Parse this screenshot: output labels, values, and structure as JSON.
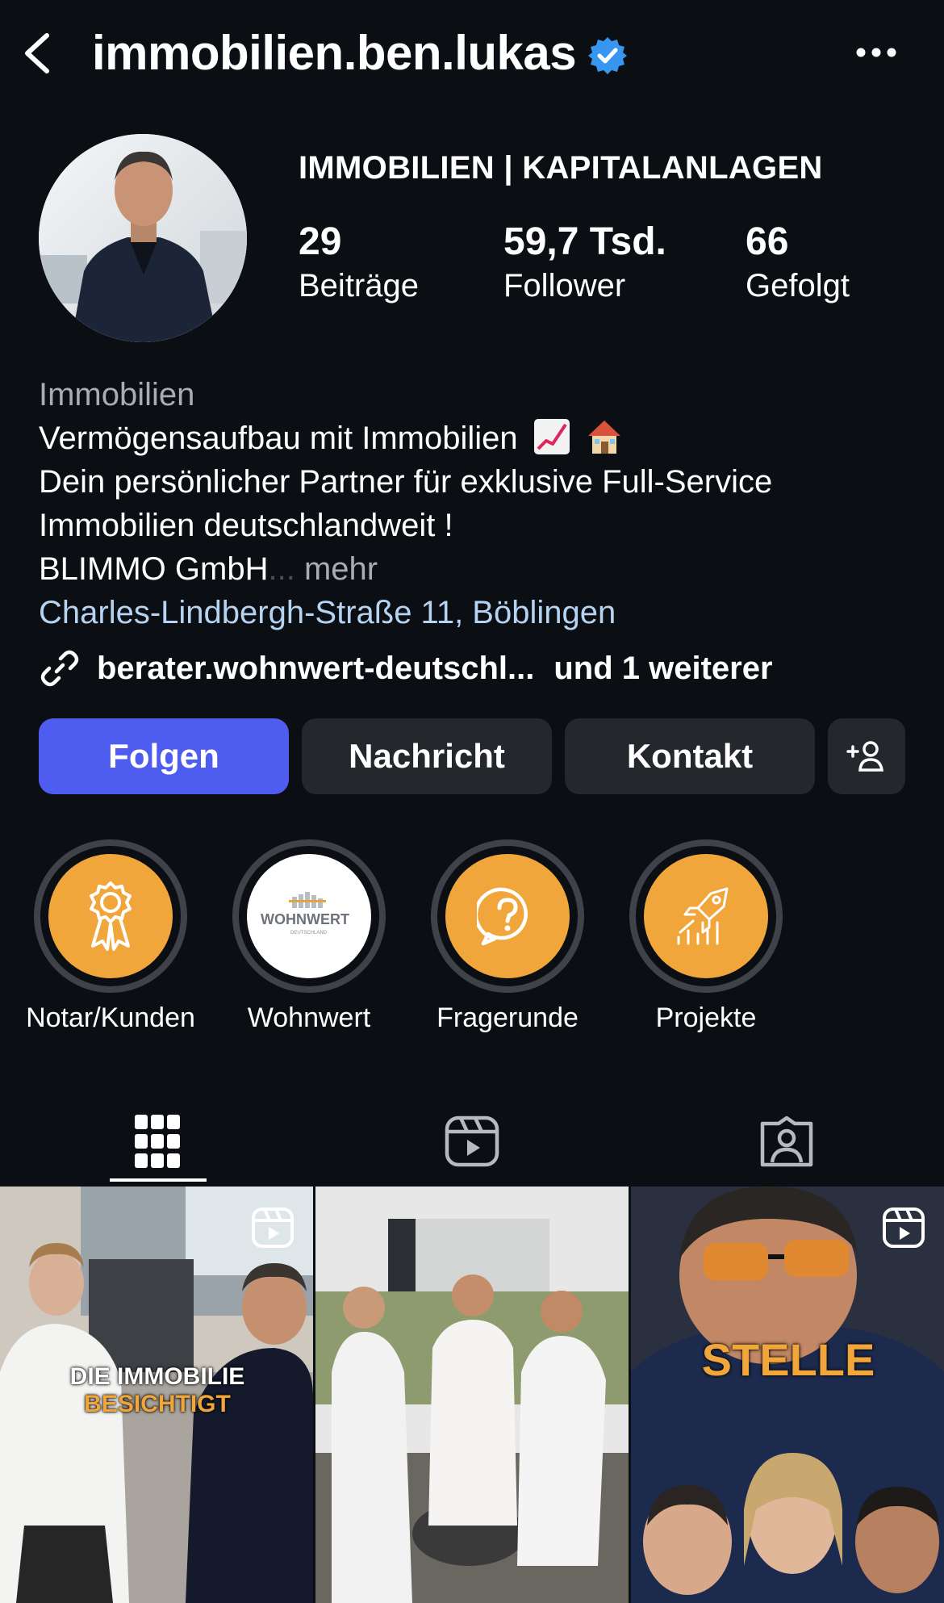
{
  "header": {
    "username": "immobilien.ben.lukas"
  },
  "profile": {
    "category_title": "IMMOBILIEN | KAPITALANLAGEN",
    "stats": [
      {
        "value": "29",
        "label": "Beiträge"
      },
      {
        "value": "59,7 Tsd.",
        "label": "Follower"
      },
      {
        "value": "66",
        "label": "Gefolgt"
      }
    ]
  },
  "bio": {
    "category": "Immobilien",
    "line1": "Vermögensaufbau mit Immobilien",
    "line2": "Dein persönlicher Partner für exklusive Full-Service",
    "line3": "Immobilien deutschlandweit !",
    "line4": "BLIMMO GmbH",
    "ellipsis": "...",
    "more": "mehr",
    "address": "Charles-Lindbergh-Straße 11, Böblingen",
    "link": "berater.wohnwert-deutschl...",
    "link_extra": "und 1 weiterer"
  },
  "buttons": {
    "follow": "Folgen",
    "message": "Nachricht",
    "contact": "Kontakt"
  },
  "highlights": [
    {
      "label": "Notar/Kunden",
      "icon": "award-ribbon-icon"
    },
    {
      "label": "Wohnwert",
      "icon": "wohnwert-logo",
      "logo_text": "WOHNWERT",
      "logo_sub": "DEUTSCHLAND"
    },
    {
      "label": "Fragerunde",
      "icon": "question-bubble-icon"
    },
    {
      "label": "Projekte",
      "icon": "rocket-chart-icon"
    }
  ],
  "tabs": [
    {
      "name": "grid",
      "icon": "grid-icon",
      "active": true
    },
    {
      "name": "reels",
      "icon": "reels-icon",
      "active": false
    },
    {
      "name": "tagged",
      "icon": "tagged-icon",
      "active": false
    }
  ],
  "posts": [
    {
      "overlay_line1": "DIE IMMOBILIE",
      "overlay_line2": "BESICHTIGT",
      "is_reel": true
    },
    {
      "is_reel": false
    },
    {
      "overlay_line1": "STELLE",
      "is_reel": true
    }
  ],
  "colors": {
    "background": "#0b0f14",
    "follow_button": "#4f5cf0",
    "secondary_button": "#24282d",
    "highlight_orange": "#f1a63b",
    "verified_blue": "#3797f0",
    "address_link": "#b7d3f2"
  }
}
